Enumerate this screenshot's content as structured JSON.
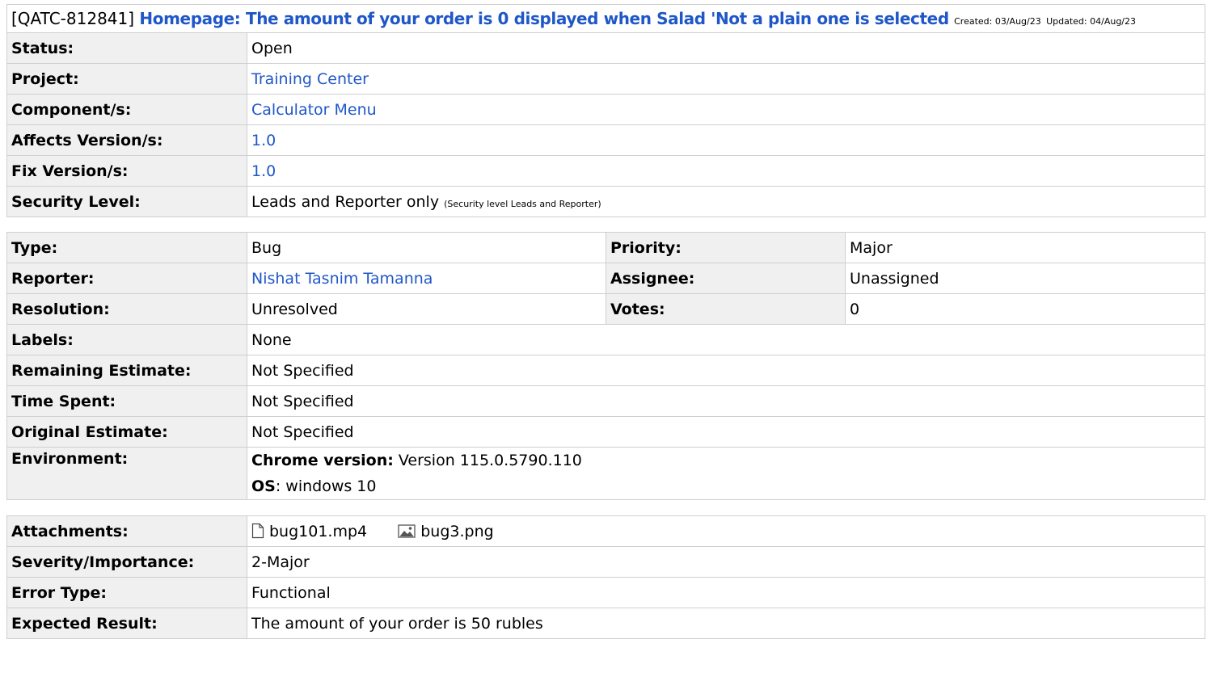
{
  "header": {
    "key": "[QATC-812841]",
    "summary": "Homepage: The amount of your order is 0 displayed when Salad 'Not a plain one is selected",
    "created": "Created: 03/Aug/23",
    "updated": "Updated: 04/Aug/23"
  },
  "details": {
    "status_label": "Status:",
    "status_value": "Open",
    "project_label": "Project:",
    "project_value": "Training Center",
    "component_label": "Component/s:",
    "component_value": "Calculator Menu",
    "affects_label": "Affects Version/s:",
    "affects_value": "1.0",
    "fix_label": "Fix Version/s:",
    "fix_value": "1.0",
    "security_label": "Security Level:",
    "security_value": "Leads and Reporter only",
    "security_note": "(Security level Leads and Reporter)"
  },
  "fields": {
    "type_label": "Type:",
    "type_value": "Bug",
    "priority_label": "Priority:",
    "priority_value": "Major",
    "reporter_label": "Reporter:",
    "reporter_value": "Nishat Tasnim Tamanna",
    "assignee_label": "Assignee:",
    "assignee_value": "Unassigned",
    "resolution_label": "Resolution:",
    "resolution_value": "Unresolved",
    "votes_label": "Votes:",
    "votes_value": "0",
    "labels_label": "Labels:",
    "labels_value": "None",
    "remaining_label": "Remaining Estimate:",
    "remaining_value": "Not Specified",
    "timespent_label": "Time Spent:",
    "timespent_value": "Not Specified",
    "original_label": "Original Estimate:",
    "original_value": "Not Specified",
    "environment_label": "Environment:",
    "env_chrome_key": "Chrome version:",
    "env_chrome_value": " Version 115.0.5790.110",
    "env_os_key": "OS",
    "env_os_value": ": windows 10"
  },
  "custom": {
    "attachments_label": "Attachments:",
    "attachments": [
      {
        "name": "bug101.mp4",
        "icon": "file-icon"
      },
      {
        "name": "bug3.png",
        "icon": "image-icon"
      }
    ],
    "severity_label": "Severity/Importance:",
    "severity_value": "2-Major",
    "errortype_label": "Error Type:",
    "errortype_value": "Functional",
    "expected_label": "Expected Result:",
    "expected_value": "The amount of your order is 50 rubles"
  },
  "colors": {
    "link": "#1f57c8",
    "label_bg": "#f0f0f0",
    "border": "#cfcfcf"
  }
}
